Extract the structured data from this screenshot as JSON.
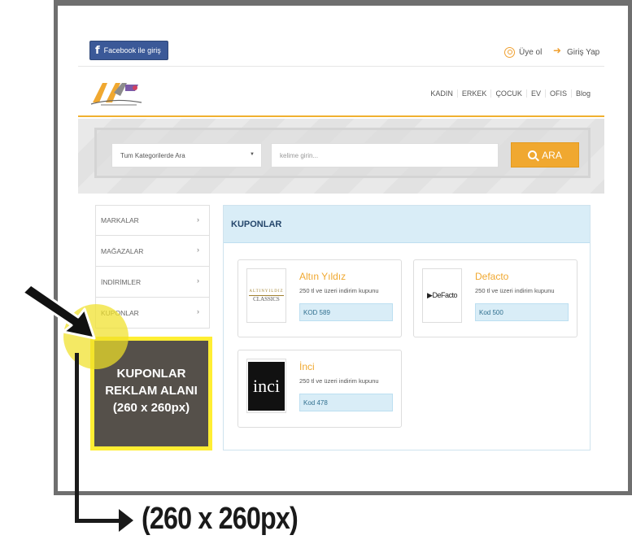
{
  "header": {
    "facebook_login": "Facebook ile giriş",
    "signup": "Üye ol",
    "login": "Giriş Yap"
  },
  "nav": {
    "items": [
      "KADIN",
      "ERKEK",
      "ÇOCUK",
      "EV",
      "OFIS",
      "Blog"
    ]
  },
  "search": {
    "category_value": "Tum Kategorilerde Ara",
    "keyword_placeholder": "kelime girin...",
    "button_label": "ARA"
  },
  "sidebar": {
    "items": [
      {
        "label": "MARKALAR"
      },
      {
        "label": "MAĞAZALAR"
      },
      {
        "label": "İNDİRİMLER"
      },
      {
        "label": "KUPONLAR"
      }
    ]
  },
  "panel": {
    "title": "KUPONLAR",
    "coupons": [
      {
        "name": "Altın Yıldız",
        "desc": "250 tl ve üzeri indirim kupunu",
        "code": "KOD 589",
        "logo_top": "ALTINYILDIZ",
        "logo_text": "CLASSICS"
      },
      {
        "name": "Defacto",
        "desc": "250 tl ve üzeri indirim kupunu",
        "code": "Kod 500",
        "logo_text": "▶DeFacto"
      },
      {
        "name": "İnci",
        "desc": "250 tl ve üzeri indirim kupunu",
        "code": "Kod 478",
        "logo_text": "inci"
      }
    ]
  },
  "ad": {
    "line1": "KUPONLAR",
    "line2": "REKLAM ALANI",
    "line3": "(260 x 260px)"
  },
  "annotation": {
    "size_label": "(260 x 260px)"
  },
  "colors": {
    "accent": "#f0a830",
    "facebook": "#3b5998",
    "panel_header": "#d9edf7",
    "ad_border": "#ffee33",
    "ad_bg": "#55504a"
  }
}
